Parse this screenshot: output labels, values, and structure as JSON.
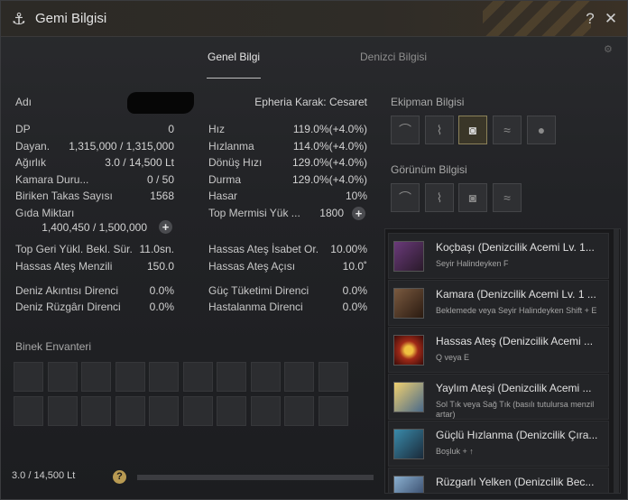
{
  "window": {
    "title": "Gemi Bilgisi"
  },
  "tabs": [
    {
      "label": "Genel Bilgi",
      "active": true
    },
    {
      "label": "Denizci Bilgisi",
      "active": false
    }
  ],
  "info": {
    "name_label": "Adı",
    "ship_type": "Epheria Karak: Cesaret",
    "left_stats": [
      {
        "label": "DP",
        "value": "0"
      },
      {
        "label": "Dayan.",
        "value": "1,315,000 / 1,315,000"
      },
      {
        "label": "Ağırlık",
        "value": "3.0 / 14,500 Lt"
      },
      {
        "label": "Kamara Duru...",
        "value": "0 / 50"
      },
      {
        "label": "Biriken Takas Sayısı",
        "value": "1568"
      },
      {
        "label": "Gıda Miktarı",
        "value": "1,400,450 / 1,500,000"
      }
    ],
    "right_stats": [
      {
        "label": "Hız",
        "value": "119.0%(+4.0%)"
      },
      {
        "label": "Hızlanma",
        "value": "114.0%(+4.0%)"
      },
      {
        "label": "Dönüş Hızı",
        "value": "129.0%(+4.0%)"
      },
      {
        "label": "Durma",
        "value": "129.0%(+4.0%)"
      },
      {
        "label": "Hasar",
        "value": "10%"
      },
      {
        "label": "Top Mermisi Yük ...",
        "value": "1800"
      }
    ],
    "cannon_left": [
      {
        "label": "Top Geri Yükl. Bekl. Sür.",
        "value": "11.0sn."
      },
      {
        "label": "Hassas Ateş Menzili",
        "value": "150.0"
      }
    ],
    "cannon_right": [
      {
        "label": "Hassas Ateş İsabet Or.",
        "value": "10.00%"
      },
      {
        "label": "Hassas Ateş Açısı",
        "value": "10.0˚"
      }
    ],
    "resist_left": [
      {
        "label": "Deniz Akıntısı Direnci",
        "value": "0.0%"
      },
      {
        "label": "Deniz Rüzgârı Direnci",
        "value": "0.0%"
      }
    ],
    "resist_right": [
      {
        "label": "Güç Tüketimi Direnci",
        "value": "0.0%"
      },
      {
        "label": "Hastalanma Direnci",
        "value": "0.0%"
      }
    ]
  },
  "inventory": {
    "title": "Binek Envanteri",
    "weight": "3.0 / 14,500 Lt",
    "help": "?",
    "weight_fraction": 0.0002
  },
  "equipment": {
    "title": "Ekipman Bilgisi",
    "slots": [
      "prow-icon",
      "figurehead-icon",
      "cannon-icon",
      "plating-icon",
      "sailor-icon"
    ],
    "filled_index": 2
  },
  "appearance": {
    "title": "Görünüm Bilgisi",
    "slots": [
      "prow-icon",
      "figurehead-icon",
      "cannon-icon",
      "plating-icon"
    ]
  },
  "skills": [
    {
      "name": "Koçbaşı (Denizcilik Acemi Lv. 1...",
      "desc": "Seyir Halindeyken F",
      "color": "#6a3a7a"
    },
    {
      "name": "Kamara (Denizcilik Acemi Lv. 1 ...",
      "desc": "Beklemede veya Seyir Halindeyken Shift + E",
      "color": "#5a4030"
    },
    {
      "name": "Hassas Ateş (Denizcilik Acemi ...",
      "desc": "Q veya E",
      "color": "#a02a18"
    },
    {
      "name": "Yaylım Ateşi (Denizcilik Acemi ...",
      "desc": "Sol Tık veya Sağ Tık (basılı tutulursa menzil artar)",
      "color": "#a07a30"
    },
    {
      "name": "Güçlü Hızlanma (Denizcilik Çıra...",
      "desc": "Boşluk + ↑",
      "color": "#2a6a8a"
    },
    {
      "name": "Rüzgarlı Yelken (Denizcilik Bec...",
      "desc": "",
      "color": "#4a6a9a"
    }
  ]
}
